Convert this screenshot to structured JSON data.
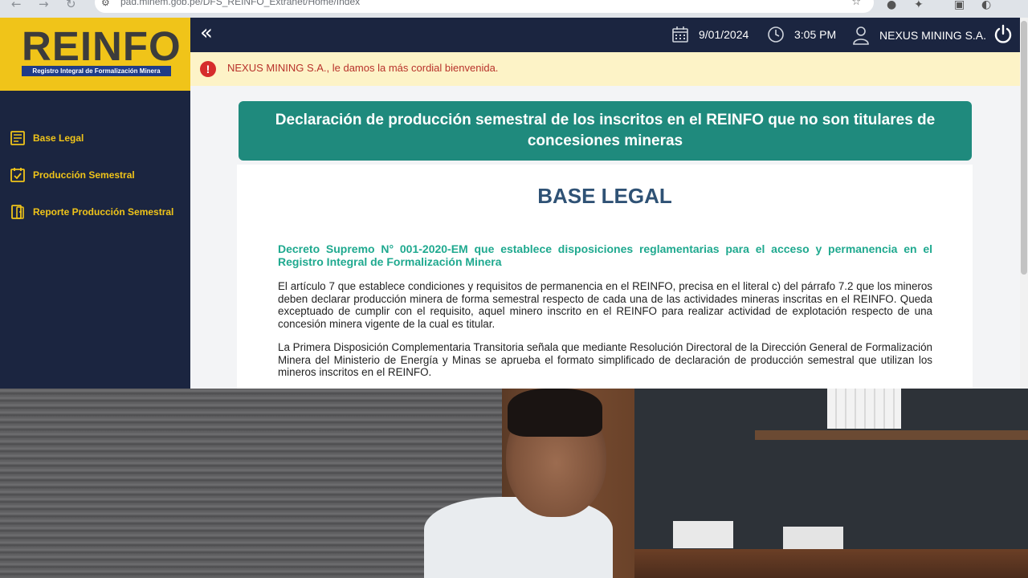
{
  "browser": {
    "url": "pad.minem.gob.pe/DFS_REINFO_Extranet/Home/Index"
  },
  "logo": {
    "word": "REINFO",
    "subtitle": "Registro Integral de Formalización Minera"
  },
  "sidebar": {
    "items": [
      {
        "label": "Base Legal",
        "icon": "document-icon"
      },
      {
        "label": "Producción Semestral",
        "icon": "checklist-icon"
      },
      {
        "label": "Reporte Producción Semestral",
        "icon": "report-icon"
      }
    ]
  },
  "header": {
    "collapse_label": "«",
    "date": "9/01/2024",
    "time": "3:05 PM",
    "user": "NEXUS MINING S.A."
  },
  "alert": {
    "text": "NEXUS MINING S.A., le damos la más cordial bienvenida."
  },
  "main": {
    "banner": "Declaración de producción semestral de los inscritos en el REINFO que no son titulares de concesiones mineras",
    "section_title": "BASE LEGAL",
    "decree": "Decreto Supremo N° 001-2020-EM que establece disposiciones reglamentarias para el acceso y permanencia en el Registro Integral de Formalización Minera",
    "paragraph_1": "El artículo 7 que establece condiciones y requisitos de permanencia en el REINFO, precisa en el literal c) del párrafo 7.2 que los mineros deben declarar producción minera de forma semestral respecto de cada una de las actividades mineras inscritas en el REINFO. Queda exceptuado de cumplir con el requisito, aquel minero inscrito en el REINFO para realizar actividad de explotación respecto de una concesión minera vigente de la cual es titular.",
    "paragraph_2": "La Primera Disposición Complementaria Transitoria señala que mediante Resolución Directoral de la Dirección General de Formalización Minera del Ministerio de Energía y Minas se aprueba el formato simplificado de declaración de producción semestral que utilizan los mineros inscritos en el REINFO."
  },
  "colors": {
    "sidebar_bg": "#1b2540",
    "accent_yellow": "#f0c419",
    "banner_teal": "#1f8a7d",
    "decree_green": "#1fa98f",
    "title_blue": "#2f5275",
    "alert_bg": "#fdf3c7",
    "alert_text": "#b8322b"
  }
}
